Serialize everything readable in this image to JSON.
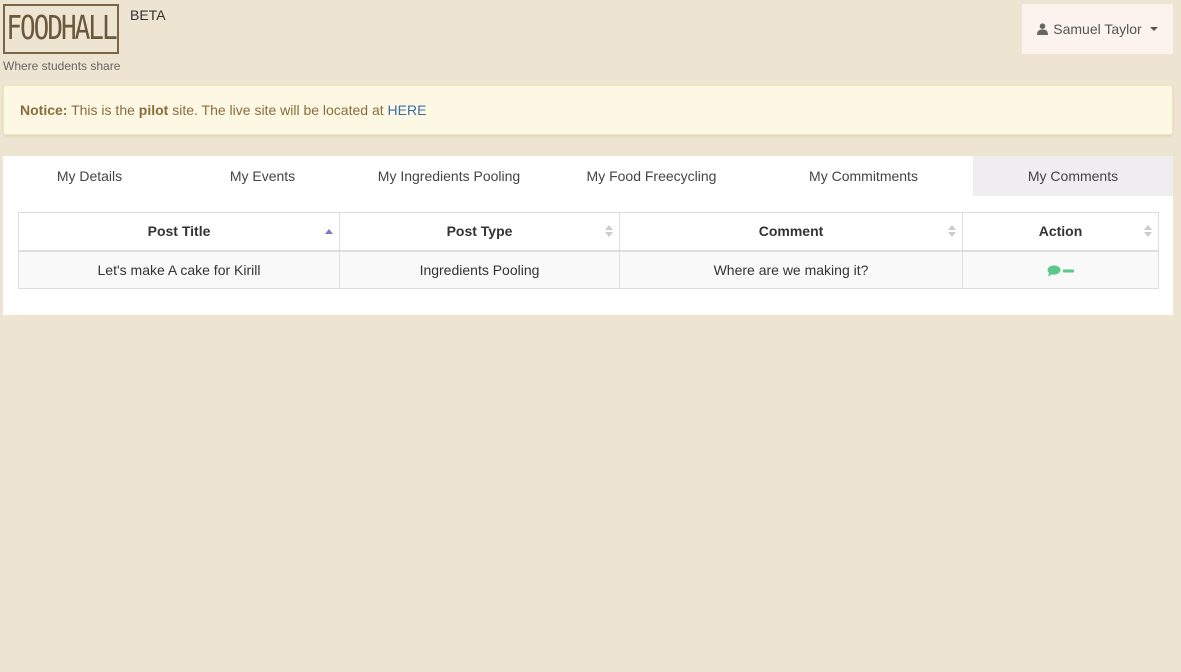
{
  "header": {
    "logo_text": "FOODHALL",
    "beta_label": "BETA",
    "tagline": "Where students share",
    "user_name": "Samuel Taylor"
  },
  "notice": {
    "label": "Notice:",
    "text_before": " This is the ",
    "bold_word": "pilot",
    "text_after": " site. The live site will be located at ",
    "link_text": "HERE"
  },
  "tabs": [
    {
      "label": "My Details",
      "active": false
    },
    {
      "label": "My Events",
      "active": false
    },
    {
      "label": "My Ingredients Pooling",
      "active": false
    },
    {
      "label": "My Food Freecycling",
      "active": false
    },
    {
      "label": "My Commitments",
      "active": false
    },
    {
      "label": "My Comments",
      "active": true
    }
  ],
  "table": {
    "columns": [
      "Post Title",
      "Post Type",
      "Comment",
      "Action"
    ],
    "rows": [
      {
        "post_title": "Let's make A cake for Kirill",
        "post_type": "Ingredients Pooling",
        "comment": "Where are we making it?"
      }
    ]
  },
  "colors": {
    "page_bg": "#ede4d1",
    "notice_bg": "#fcf8e3",
    "notice_text": "#8a6d3b",
    "link": "#3b6ea5",
    "action_green": "#5cc88a",
    "sort_active": "#7b78c8"
  },
  "icons": {
    "user": "user-icon",
    "comment": "comment-icon",
    "remove": "minus-icon"
  }
}
